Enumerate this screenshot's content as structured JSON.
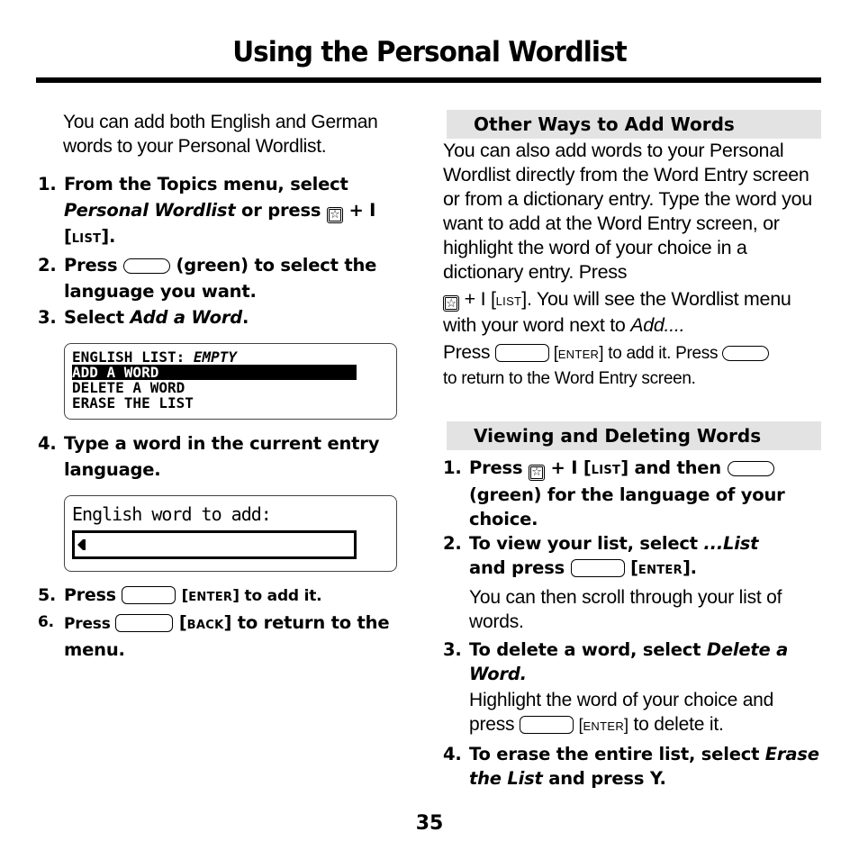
{
  "page": {
    "title": "Using the Personal Wordlist",
    "page_number": "35"
  },
  "left": {
    "intro": "You can add both English and German words to your Personal Wordlist.",
    "steps": [
      {
        "num": "1.",
        "a": "From the Topics menu, select ",
        "b_italic": "Personal Wordlist",
        "c": " or press ",
        "d": " + I [",
        "sc": "LIST",
        "e": "]."
      },
      {
        "num": "2.",
        "a": "Press ",
        "b": " (green) to select the language you want."
      },
      {
        "num": "3.",
        "a": "Select ",
        "b_italic": "Add a Word",
        "c": "."
      },
      {
        "num": "4.",
        "a": "Type a word in the current entry language."
      },
      {
        "num": "5.",
        "a": "Press ",
        "sc": "ENTER",
        "b": " to add it."
      },
      {
        "num": "6.",
        "a": "Press ",
        "sc": "BACK",
        "b": " to return to the menu."
      }
    ],
    "screen1": {
      "line1": "ENGLISH LIST: ",
      "line1_italic": "EMPTY",
      "items": [
        "ADD A WORD",
        "DELETE A WORD",
        "ERASE THE LIST"
      ],
      "selected": "ADD A WORD"
    },
    "screen2": {
      "prompt": "English word to add:",
      "value": ""
    }
  },
  "right": {
    "section1": {
      "heading": "Other Ways to Add Words",
      "p1": "You can also add words to your Personal Wordlist directly from the Word Entry screen or from a dictionary entry. Type the word you want to add at the Word Entry screen, or highlight the word of your choice in a dictionary entry. Press",
      "p2a": " + I [",
      "p2sc": "LIST",
      "p2b": "]. You will see the Wordlist menu with your word next to ",
      "p2italic": "Add....",
      "p3a": "Press ",
      "p3sc": "ENTER",
      "p3b": " to add it. Press ",
      "p3c": " to return to the Word Entry screen."
    },
    "section2": {
      "heading": "Viewing and Deleting Words",
      "steps": [
        {
          "num": "1.",
          "a": "Press ",
          "b": " + I [",
          "sc": "LIST",
          "c": "] and then ",
          "d": " (green) for the language of your choice."
        },
        {
          "num": "2.",
          "a": "To view your list, select ",
          "b_italic": "...List",
          "c": " and press ",
          "sc": "ENTER",
          "d": "].",
          "sub": "You can then scroll through your list of words."
        },
        {
          "num": "3.",
          "a": "To delete a word, select ",
          "b_italic": "Delete a Word.",
          "sub_a": "Highlight the word of your choice and press ",
          "sub_sc": "ENTER",
          "sub_b": " to delete it."
        },
        {
          "num": "4.",
          "a": "To erase the entire list, select ",
          "b_italic": "Erase the List",
          "c": " and press Y."
        }
      ]
    }
  },
  "icons": {
    "star_key": "☆"
  }
}
